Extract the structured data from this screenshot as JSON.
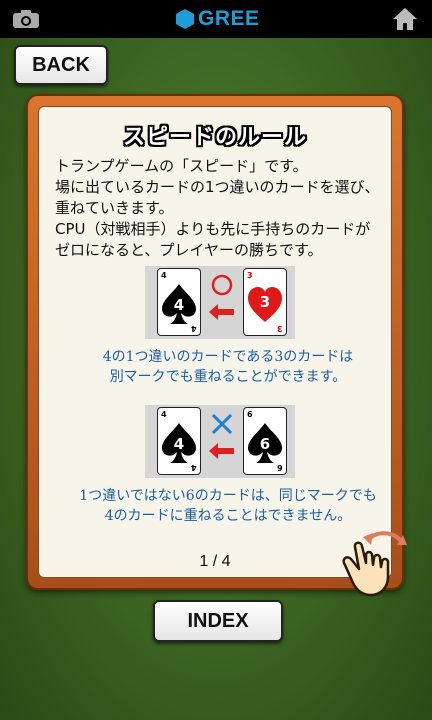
{
  "statusbar": {
    "brand": "GREE",
    "camera_icon": "camera-icon",
    "home_icon": "home-icon"
  },
  "back_button": "BACK",
  "rules": {
    "title": "スピードのルール",
    "description": [
      "トランプゲームの「スピード」です。",
      "場に出ているカードの1つ違いのカードを選び、",
      "重ねていきます。",
      "CPU（対戦相手）よりも先に手持ちのカードが",
      "ゼロになると、プレイヤーの勝ちです。"
    ],
    "example1": {
      "left_card": {
        "rank": "4",
        "suit": "spade"
      },
      "right_card": {
        "rank": "3",
        "suit": "heart"
      },
      "mark": "circle",
      "note": [
        "4の1つ違いのカードである3のカードは",
        "別マークでも重ねることができます。"
      ]
    },
    "example2": {
      "left_card": {
        "rank": "4",
        "suit": "spade"
      },
      "right_card": {
        "rank": "6",
        "suit": "spade"
      },
      "mark": "cross",
      "note": [
        "1つ違いではない6のカードは、同じマークでも",
        "4のカードに重ねることはできません。"
      ]
    },
    "page_indicator": "1 / 4",
    "swipe_hint_icon": "swipe-hand-icon"
  },
  "index_button": "INDEX",
  "colors": {
    "brand": "#1f9fd8",
    "panel_frame": "#c9642a",
    "note_text": "#1a5fa8",
    "arrow": "#e02020",
    "circle_mark": "#e02020",
    "cross_mark": "#1d7fd6"
  }
}
